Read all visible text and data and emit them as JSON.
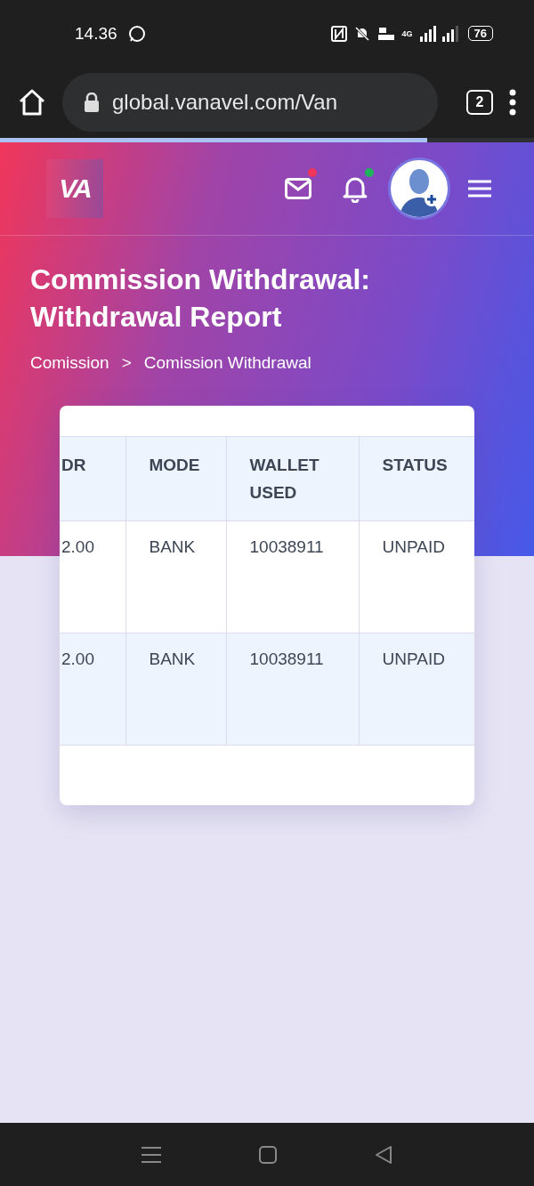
{
  "status_bar": {
    "time": "14.36",
    "network": "4G",
    "battery": "76"
  },
  "browser": {
    "url": "global.vanavel.com/Van",
    "tab_count": "2",
    "load_progress": {
      "level": 0.8
    }
  },
  "header": {
    "logo": "VA",
    "mail_badge": {
      "color": "#f0365a"
    },
    "bell_badge": {
      "color": "#1fb35a"
    }
  },
  "page": {
    "title": "Commission Withdrawal: Withdrawal Report",
    "breadcrumb": [
      "Comission",
      ">",
      "Comission Withdrawal"
    ]
  },
  "table": {
    "columns": [
      "DR",
      "MODE",
      "WALLET USED",
      "STATUS"
    ],
    "rows": [
      [
        "2.00",
        "BANK",
        "10038911",
        "UNPAID"
      ],
      [
        "2.00",
        "BANK",
        "10038911",
        "UNPAID"
      ]
    ]
  }
}
